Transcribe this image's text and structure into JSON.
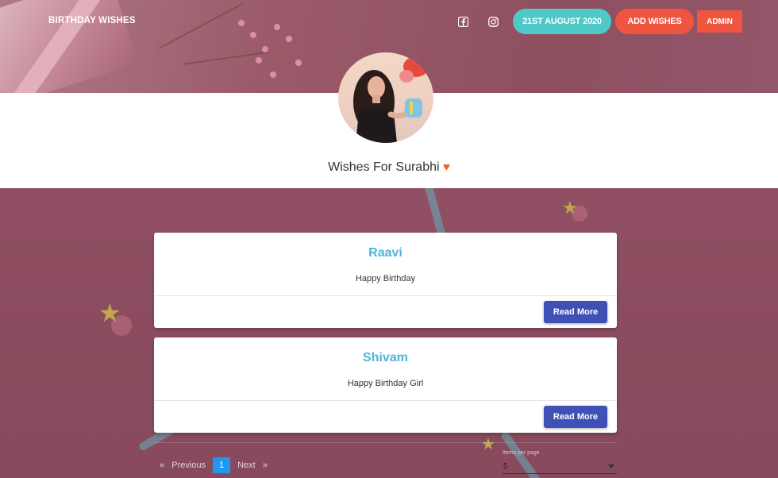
{
  "nav": {
    "brand": "BIRTHDAY WISHES",
    "date_button": "21ST AUGUST 2020",
    "add_button": "ADD WISHES",
    "admin_button": "ADMIN",
    "icons": [
      "facebook-icon",
      "instagram-icon"
    ]
  },
  "profile": {
    "title": "Wishes For Surabhi",
    "heart": "♥"
  },
  "wishes": [
    {
      "name": "Raavi",
      "message": "Happy Birthday",
      "action": "Read More"
    },
    {
      "name": "Shivam",
      "message": "Happy Birthday Girl",
      "action": "Read More"
    }
  ],
  "pagination": {
    "prev_arrow": "«",
    "prev": "Previous",
    "current_page": "1",
    "next": "Next",
    "next_arrow": "»",
    "items_label": "Items per page",
    "items_value": "5"
  },
  "colors": {
    "date_button": "#4fc8c8",
    "accent_button": "#f0553f",
    "read_more": "#3f51b5",
    "name_text": "#4fb3d6",
    "active_page": "#2196f3",
    "heart": "#f26128"
  }
}
